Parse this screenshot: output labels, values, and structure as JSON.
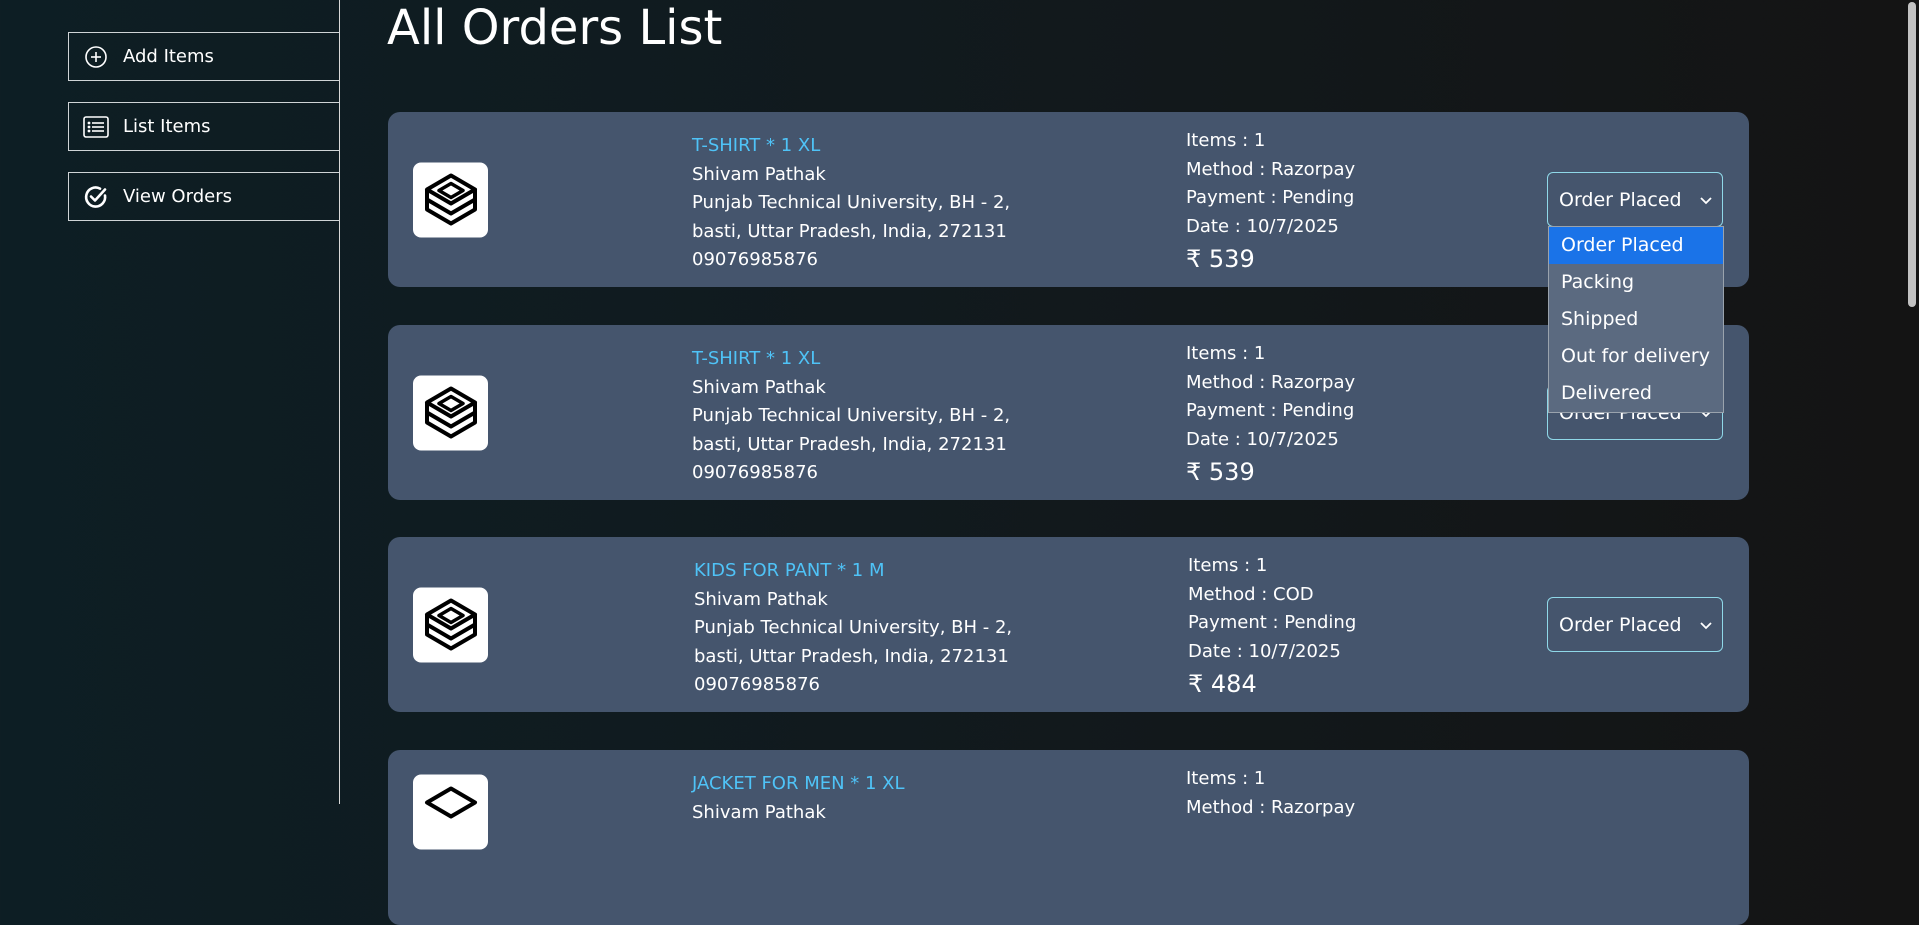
{
  "sidebar": {
    "items": [
      {
        "label": "Add Items",
        "icon": "plus-circle-icon"
      },
      {
        "label": "List Items",
        "icon": "list-icon"
      },
      {
        "label": "View Orders",
        "icon": "check-circle-icon"
      }
    ]
  },
  "page": {
    "title": "All Orders List"
  },
  "colors": {
    "card_bg": "#45556d",
    "product_text": "#4fc3f7",
    "select_border": "#8fd8e8",
    "dropdown_selected": "#1a73e8"
  },
  "orders": [
    {
      "product": "T-SHIRT * 1 XL",
      "name": "Shivam Pathak",
      "address1": "Punjab Technical University, BH - 2,",
      "address2": "basti, Uttar Pradesh, India, 272131",
      "phone": "09076985876",
      "items": "Items : 1",
      "method": "Method : Razorpay",
      "payment": "Payment : Pending",
      "date": "Date : 10/7/2025",
      "amount": "₹ 539",
      "status": "Order Placed"
    },
    {
      "product": "T-SHIRT * 1 XL",
      "name": "Shivam Pathak",
      "address1": "Punjab Technical University, BH - 2,",
      "address2": "basti, Uttar Pradesh, India, 272131",
      "phone": "09076985876",
      "items": "Items : 1",
      "method": "Method : Razorpay",
      "payment": "Payment : Pending",
      "date": "Date : 10/7/2025",
      "amount": "₹ 539",
      "status": "Order Placed"
    },
    {
      "product": "KIDS FOR PANT * 1 M",
      "name": "Shivam Pathak",
      "address1": "Punjab Technical University, BH - 2,",
      "address2": "basti, Uttar Pradesh, India, 272131",
      "phone": "09076985876",
      "items": "Items : 1",
      "method": "Method : COD",
      "payment": "Payment : Pending",
      "date": "Date : 10/7/2025",
      "amount": "₹ 484",
      "status": "Order Placed"
    },
    {
      "product": "JACKET FOR MEN * 1 XL",
      "name": "Shivam Pathak",
      "address1": "",
      "address2": "",
      "phone": "",
      "items": "Items : 1",
      "method": "Method : Razorpay",
      "payment": "",
      "date": "",
      "amount": "",
      "status": ""
    }
  ],
  "status_dropdown": {
    "open": true,
    "selected": "Order Placed",
    "options": [
      "Order Placed",
      "Packing",
      "Shipped",
      "Out for delivery",
      "Delivered"
    ]
  }
}
